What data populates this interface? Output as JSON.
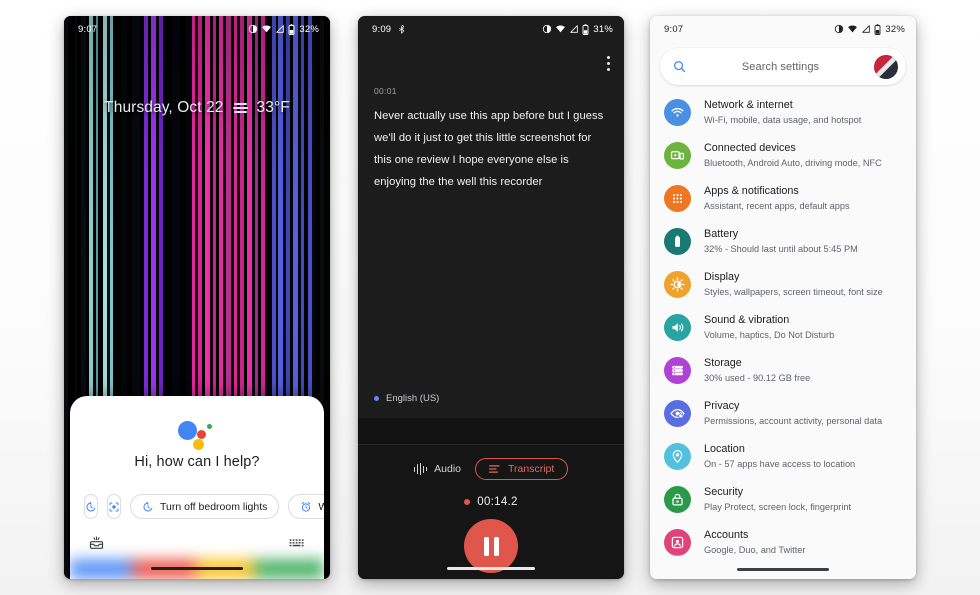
{
  "background_color": "#ffffff",
  "phones": {
    "lockscreen": {
      "status_bar": {
        "time": "9:07",
        "battery_percent": "32%"
      },
      "lock_info": {
        "date": "Thursday, Oct 22",
        "temperature": "33°F",
        "weather_icon": "haze-icon"
      },
      "assistant": {
        "greeting": "Hi, how can I help?",
        "logo": "google-assistant-logo",
        "chips": [
          {
            "label": "",
            "icon": "history-icon"
          },
          {
            "label": "",
            "icon": "lens-icon"
          },
          {
            "label": "Turn off bedroom lights",
            "icon": "history-icon"
          },
          {
            "label": "W",
            "icon": "alarm-icon"
          }
        ],
        "footer": {
          "left_icon": "inbox-keyboard-icon",
          "right_icon": "keyboard-icon"
        }
      },
      "colors": {
        "accent_blue": "#4285F4",
        "accent_red": "#EA4335",
        "accent_yellow": "#FBBC05",
        "accent_green": "#34A853"
      }
    },
    "recorder": {
      "status_bar": {
        "time": "9:09",
        "battery_percent": "31%",
        "extra_icon": "bluetooth-audio-icon"
      },
      "menu_icon": "overflow-menu-icon",
      "transcript": {
        "timestamp": "00:01",
        "text": "Never actually use this app before but I guess we'll do it just to get this little screenshot for this one review I hope everyone else is enjoying the the well this recorder"
      },
      "language": "English (US)",
      "tabs": [
        {
          "label": "Audio",
          "icon": "waveform-icon",
          "selected": false
        },
        {
          "label": "Transcript",
          "icon": "transcript-lines-icon",
          "selected": true
        }
      ],
      "timer": "00:14.2",
      "record_button": {
        "icon": "pause-icon",
        "color": "#e0564a"
      },
      "colors": {
        "accent": "#e2695d",
        "bg": "#1c1c1c",
        "bottom_bg": "#151515"
      }
    },
    "settings": {
      "status_bar": {
        "time": "9:07",
        "battery_percent": "32%"
      },
      "search": {
        "placeholder": "Search settings",
        "icon": "search-icon",
        "avatar": "user-avatar"
      },
      "items": [
        {
          "title": "Network & internet",
          "subtitle": "Wi-Fi, mobile, data usage, and hotspot",
          "icon": "wifi-icon",
          "color": "#4a90e2"
        },
        {
          "title": "Connected devices",
          "subtitle": "Bluetooth, Android Auto, driving mode, NFC",
          "icon": "devices-icon",
          "color": "#6cb33f"
        },
        {
          "title": "Apps & notifications",
          "subtitle": "Assistant, recent apps, default apps",
          "icon": "apps-grid-icon",
          "color": "#ef7622"
        },
        {
          "title": "Battery",
          "subtitle": "32% - Should last until about 5:45 PM",
          "icon": "battery-icon",
          "color": "#1a7a72"
        },
        {
          "title": "Display",
          "subtitle": "Styles, wallpapers, screen timeout, font size",
          "icon": "brightness-icon",
          "color": "#f0a32c"
        },
        {
          "title": "Sound & vibration",
          "subtitle": "Volume, haptics, Do Not Disturb",
          "icon": "volume-icon",
          "color": "#2aa3a3"
        },
        {
          "title": "Storage",
          "subtitle": "30% used - 90.12 GB free",
          "icon": "storage-icon",
          "color": "#b042d6"
        },
        {
          "title": "Privacy",
          "subtitle": "Permissions, account activity, personal data",
          "icon": "privacy-eye-icon",
          "color": "#5b6ee0"
        },
        {
          "title": "Location",
          "subtitle": "On - 57 apps have access to location",
          "icon": "location-pin-icon",
          "color": "#53c0dd"
        },
        {
          "title": "Security",
          "subtitle": "Play Protect, screen lock, fingerprint",
          "icon": "lock-icon",
          "color": "#2a9a4a"
        },
        {
          "title": "Accounts",
          "subtitle": "Google, Duo, and Twitter",
          "icon": "account-icon",
          "color": "#e0427a"
        }
      ]
    }
  }
}
